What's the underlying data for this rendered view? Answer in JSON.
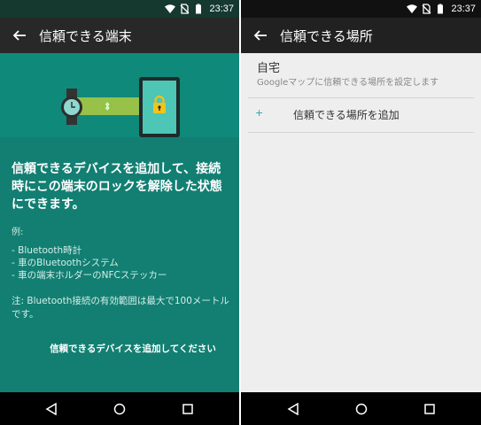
{
  "left": {
    "status": {
      "time": "23:37",
      "icons": [
        "wifi-icon",
        "no-sim-icon",
        "battery-icon"
      ]
    },
    "toolbar": {
      "title": "信頼できる端末",
      "back_icon": "arrow-back-icon"
    },
    "hero": {
      "icons": [
        "smartwatch-icon",
        "bluetooth-icon",
        "tablet-lock-icon"
      ],
      "colors": {
        "band": "#a6c844",
        "screen": "#4dc6b6",
        "lock": "#f4c21b"
      }
    },
    "lead": "信頼できるデバイスを追加して、接続時にこの端末のロックを解除した状態にできます。",
    "example_label": "例:",
    "examples": [
      "- Bluetooth時計",
      "- 車のBluetoothシステム",
      "- 車の端末ホルダーのNFCステッカー"
    ],
    "note": "注: Bluetooth接続の有効範囲は最大で100メートルです。",
    "add_device": "信頼できるデバイスを追加してください",
    "nav": [
      "back-nav-icon",
      "home-nav-icon",
      "recents-nav-icon"
    ]
  },
  "right": {
    "status": {
      "time": "23:37",
      "icons": [
        "wifi-icon",
        "no-sim-icon",
        "battery-icon"
      ]
    },
    "toolbar": {
      "title": "信頼できる場所",
      "back_icon": "arrow-back-icon"
    },
    "home": {
      "name": "自宅",
      "desc": "Googleマップに信頼できる場所を設定します"
    },
    "add_place": {
      "icon": "+",
      "label": "信頼できる場所を追加"
    },
    "nav": [
      "back-nav-icon",
      "home-nav-icon",
      "recents-nav-icon"
    ]
  },
  "colors": {
    "accent_teal": "#127f72",
    "hero_teal": "#0f897a",
    "toolbar": "#282828"
  }
}
